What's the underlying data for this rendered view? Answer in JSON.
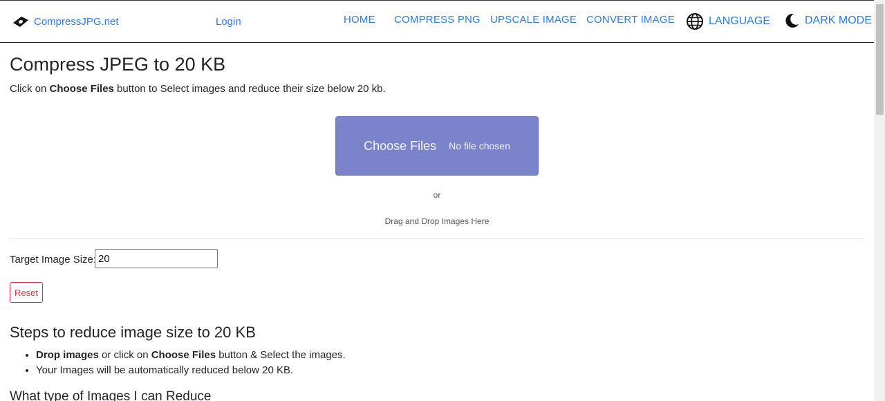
{
  "nav": {
    "brand": "CompressJPG.net",
    "login": "Login",
    "links": [
      "HOME",
      "COMPRESS PNG",
      "UPSCALE IMAGE",
      "CONVERT IMAGE"
    ],
    "language": "LANGUAGE",
    "dark_mode": "DARK MODE",
    "link_color": "#2a7ae2"
  },
  "main": {
    "title": "Compress JPEG to 20 KB",
    "intro_prefix": "Click on ",
    "intro_bold": "Choose Files",
    "intro_suffix": " button to Select images and reduce their size below 20 kb.",
    "upload": {
      "button_label": "Choose Files",
      "status": "No file chosen",
      "color": "#7b83ca"
    },
    "or_text": "or",
    "drag_text": "Drag and Drop Images Here",
    "target_label": "Target Image Size:",
    "target_value": "20",
    "reset_label": "Reset",
    "reset_color": "#dc3545",
    "steps_title": "Steps to reduce image size to 20 KB",
    "steps": {
      "item1_bold": "Drop images",
      "item1_mid": " or click on ",
      "item1_bold2": "Choose Files",
      "item1_suffix": " button & Select the images.",
      "item2": "Your Images will be automatically reduced below 20 KB."
    },
    "types_title": "What type of Images I can Reduce"
  },
  "icons": {
    "brand": "eye-logo-icon",
    "language": "globe-icon",
    "dark_mode": "moon-icon"
  }
}
